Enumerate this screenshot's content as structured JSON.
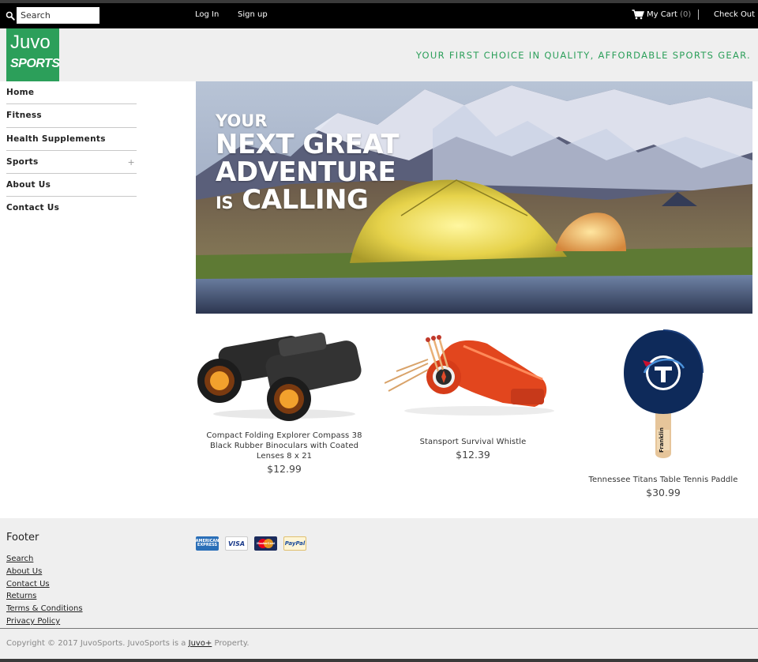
{
  "topbar": {
    "search_placeholder": "Search",
    "login_label": "Log In",
    "signup_label": "Sign up",
    "cart_label": "My Cart",
    "cart_count": "(0)",
    "checkout_label": "Check Out"
  },
  "header": {
    "logo_top": "Juvo",
    "logo_bottom": "SPORTS",
    "tagline": "YOUR FIRST CHOICE IN QUALITY, AFFORDABLE SPORTS GEAR."
  },
  "sidebar": {
    "items": [
      {
        "label": "Home"
      },
      {
        "label": "Fitness"
      },
      {
        "label": "Health Supplements"
      },
      {
        "label": "Sports",
        "expand": "+"
      },
      {
        "label": "About Us"
      },
      {
        "label": "Contact Us"
      }
    ]
  },
  "hero": {
    "line1": "YOUR",
    "line2": "NEXT GREAT",
    "line3": "ADVENTURE",
    "line4_small": "IS",
    "line4_big": "CALLING"
  },
  "products": [
    {
      "name": "Compact Folding Explorer Compass 38 Black Rubber Binoculars with Coated Lenses 8 x 21",
      "price": "$12.99",
      "icon": "binoculars-icon"
    },
    {
      "name": "Stansport Survival Whistle",
      "price": "$12.39",
      "icon": "whistle-icon"
    },
    {
      "name": "Tennessee Titans Table Tennis Paddle",
      "price": "$30.99",
      "icon": "paddle-icon"
    }
  ],
  "footer": {
    "title": "Footer",
    "links": [
      "Search",
      "About Us",
      "Contact Us",
      "Returns",
      "Terms & Conditions",
      "Privacy Policy"
    ],
    "payments": {
      "amex": "AMERICAN EXPRESS",
      "visa": "VISA",
      "mastercard": "MasterCard",
      "paypal": "PayPal"
    },
    "copyright_prefix": "Copyright © 2017 JuvoSports. JuvoSports is a",
    "copyright_link": "Juvo+",
    "copyright_suffix": "Property."
  },
  "colors": {
    "brand_green": "#2c9f5a",
    "topbar_bg": "#000000",
    "header_bg": "#efefef"
  }
}
